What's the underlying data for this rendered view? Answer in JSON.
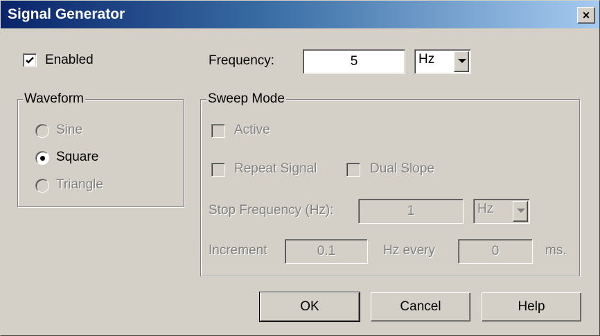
{
  "window": {
    "title": "Signal Generator",
    "close_glyph": "×"
  },
  "enabled": {
    "label": "Enabled",
    "checked": true
  },
  "frequency": {
    "label": "Frequency:",
    "value": "5",
    "unit": "Hz"
  },
  "waveform": {
    "legend": "Waveform",
    "options": [
      {
        "label": "Sine",
        "selected": false,
        "enabled": false
      },
      {
        "label": "Square",
        "selected": true,
        "enabled": true
      },
      {
        "label": "Triangle",
        "selected": false,
        "enabled": false
      }
    ]
  },
  "sweep": {
    "legend": "Sweep Mode",
    "active_label": "Active",
    "repeat_label": "Repeat Signal",
    "dual_slope_label": "Dual Slope",
    "stop_freq_label": "Stop Frequency (Hz):",
    "stop_freq_value": "1",
    "stop_freq_unit": "Hz",
    "increment_label": "Increment",
    "increment_value": "0.1",
    "hz_every_label": "Hz every",
    "interval_value": "0",
    "ms_label": "ms."
  },
  "buttons": {
    "ok": "OK",
    "cancel": "Cancel",
    "help": "Help"
  },
  "icons": {
    "close": "close-icon",
    "check": "checkmark-icon",
    "dropdown": "chevron-down-icon"
  }
}
